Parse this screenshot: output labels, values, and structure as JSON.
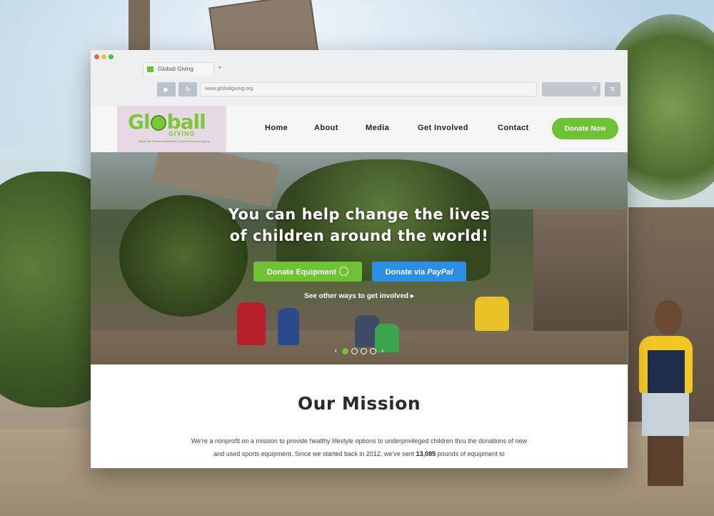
{
  "browser": {
    "tab_title": "Globall Giving",
    "url": "www.globallgiving.org"
  },
  "logo": {
    "big_prefix": "Gl",
    "big_suffix": "ball",
    "small": "GIVING",
    "tagline": "Sports for Children Worldwide & more, thru sports giving"
  },
  "nav": {
    "items": [
      "Home",
      "About",
      "Media",
      "Get Involved",
      "Contact"
    ],
    "donate_button": "Donate Now"
  },
  "hero": {
    "headline_line1": "You can help change the lives",
    "headline_line2": "of children around the world!",
    "donate_equipment": "Donate Equipment",
    "donate_paypal_prefix": "Donate via",
    "donate_paypal_brand": "PayPal",
    "other_ways": "See other ways to get involved ▸",
    "carousel": {
      "slides": 4,
      "active": 1
    }
  },
  "mission": {
    "title": "Our Mission",
    "text_before": "We're a nonprofit on a mission to provide healthy lifestyle options to underprivileged children thru the donations of new and used sports equipment. Since we started back in 2012, we've sent ",
    "pounds": "13,085",
    "text_after": " pounds of equipment to"
  },
  "colors": {
    "accent_green": "#6fc235",
    "paypal_blue": "#2d8ee6",
    "traffic_red": "#ee5f57",
    "traffic_yellow": "#f6be2f",
    "traffic_green": "#3fc54f"
  },
  "icons": [
    "play-icon",
    "refresh-icon",
    "search-icon",
    "menu-icon",
    "soccer-ball-icon",
    "chevron-left-icon",
    "chevron-right-icon"
  ]
}
